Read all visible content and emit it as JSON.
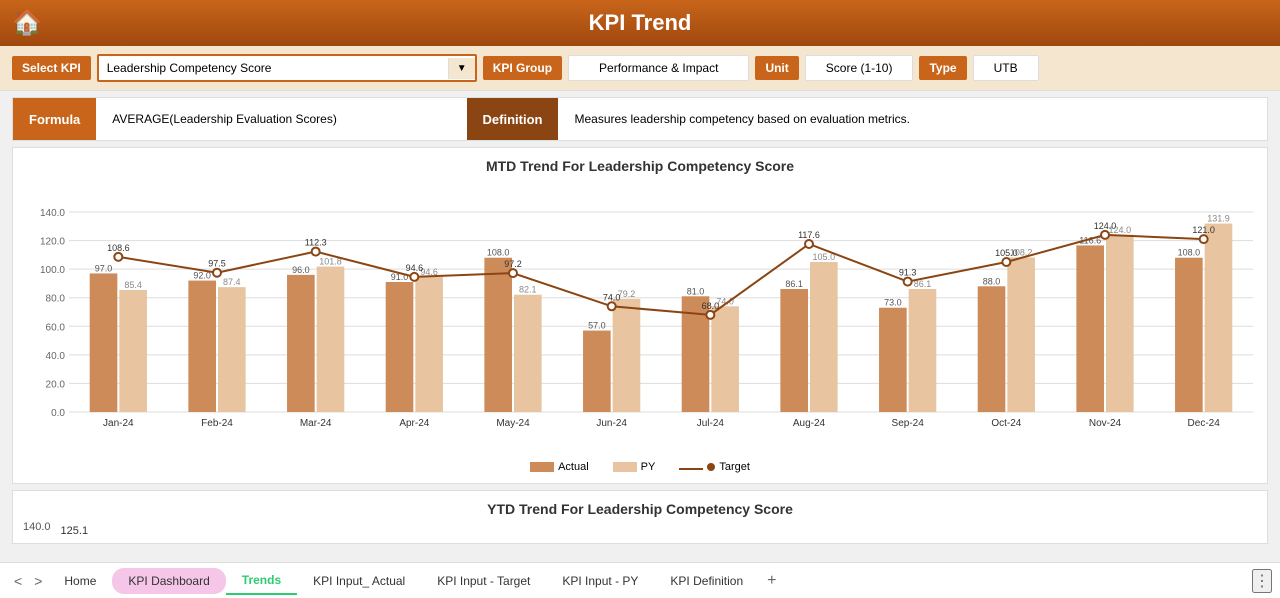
{
  "header": {
    "title": "KPI Trend",
    "home_icon": "🏠"
  },
  "kpi_bar": {
    "select_label": "Select KPI",
    "selected_kpi": "Leadership Competency Score",
    "group_label": "KPI Group",
    "group_value": "Performance & Impact",
    "unit_label": "Unit",
    "unit_value": "Score (1-10)",
    "type_label": "Type",
    "type_value": "UTB"
  },
  "formula_section": {
    "formula_label": "Formula",
    "formula_text": "AVERAGE(Leadership Evaluation Scores)",
    "definition_label": "Definition",
    "definition_text": "Measures leadership competency based on evaluation metrics."
  },
  "mtd_chart": {
    "title": "MTD Trend For Leadership Competency Score",
    "y_max": 140.0,
    "y_min": 0.0,
    "months": [
      "Jan-24",
      "Feb-24",
      "Mar-24",
      "Apr-24",
      "May-24",
      "Jun-24",
      "Jul-24",
      "Aug-24",
      "Sep-24",
      "Oct-24",
      "Nov-24",
      "Dec-24"
    ],
    "actual": [
      97.0,
      92.0,
      96.0,
      91.0,
      108.0,
      57.0,
      81.0,
      86.1,
      73.0,
      88.0,
      116.6,
      108.0
    ],
    "py": [
      85.4,
      87.4,
      101.8,
      94.6,
      82.1,
      79.2,
      74.0,
      105.0,
      86.1,
      108.2,
      124.0,
      131.9
    ],
    "target": [
      108.6,
      97.5,
      112.3,
      94.6,
      97.2,
      74.0,
      68.0,
      117.6,
      91.3,
      105.0,
      124.0,
      121.0
    ],
    "legend": {
      "actual": "Actual",
      "py": "PY",
      "target": "Target"
    }
  },
  "ytd_chart": {
    "title": "YTD Trend For Leadership Competency Score",
    "y_max": 140.0,
    "first_label": "125.1"
  },
  "bottom_tabs": {
    "nav_prev": "<",
    "nav_next": ">",
    "tabs": [
      {
        "label": "Home",
        "active": false,
        "highlighted": false
      },
      {
        "label": "KPI Dashboard",
        "active": false,
        "highlighted": true
      },
      {
        "label": "Trends",
        "active": true,
        "highlighted": false
      },
      {
        "label": "KPI Input_ Actual",
        "active": false,
        "highlighted": false
      },
      {
        "label": "KPI Input - Target",
        "active": false,
        "highlighted": false
      },
      {
        "label": "KPI Input - PY",
        "active": false,
        "highlighted": false
      },
      {
        "label": "KPI Definition",
        "active": false,
        "highlighted": false
      }
    ],
    "add": "+",
    "more": "⋮"
  },
  "colors": {
    "header_bg": "#c8651a",
    "actual_bar": "#cd8b5a",
    "py_bar": "#e8c4a0",
    "target_line": "#8B4513",
    "accent": "#c8651a"
  }
}
